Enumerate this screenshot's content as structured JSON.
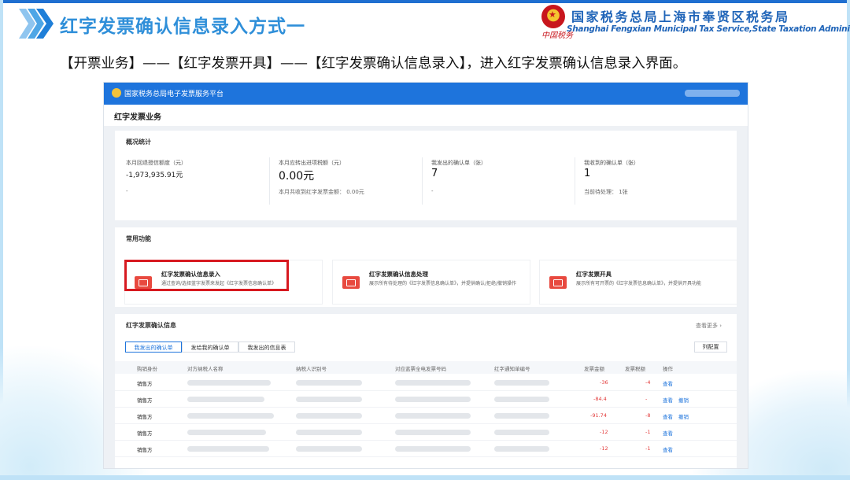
{
  "slide": {
    "title": "红字发票确认信息录入方式一",
    "agency_cn": "国家税务总局上海市奉贤区税务局",
    "agency_en": "Shanghai Fengxian Municipal Tax Service,State Taxation Administration",
    "agency_calligraphy": "中国税务",
    "instruction": "【开票业务】——【红字发票开具】——【红字发票确认信息录入】，进入红字发票确认信息录入界面。",
    "colors": {
      "title_blue": "#2f8fd9",
      "agency_blue": "#1f64b8",
      "highlight_red": "#d71920"
    }
  },
  "app": {
    "platform_title": "国家税务总局电子发票服务平台",
    "page_title": "红字发票业务",
    "colors": {
      "topbar": "#1e74dc",
      "amount_red": "#e23b3b",
      "link_blue": "#1e74dc"
    }
  },
  "overview": {
    "title": "概况统计",
    "stats": [
      {
        "label": "本月回退授信额度（元）",
        "value": "-1,973,935.91元",
        "sub": "-"
      },
      {
        "label": "本月应转出进项税额（元）",
        "value": "0.00元",
        "sub": "本月共收到红字发票金额：  0.00元"
      },
      {
        "label": "我发出的确认单（张）",
        "value": "7",
        "sub": "-"
      },
      {
        "label": "我收到的确认单（张）",
        "value": "1",
        "sub": "当前待处理：  1张"
      }
    ]
  },
  "common_functions": {
    "title": "常用功能",
    "items": [
      {
        "name": "红字发票确认信息录入",
        "desc": "通过查询/选择蓝字发票来发起《红字发票信息确认单》"
      },
      {
        "name": "红字发票确认信息处理",
        "desc": "展示所有待处理的《红字发票信息确认单》，并提供确认/拒绝/撤销操作"
      },
      {
        "name": "红字发票开具",
        "desc": "展示所有可开票的《红字发票信息确认单》，并提供开具功能"
      }
    ]
  },
  "confirm_info": {
    "title": "红字发票确认信息",
    "more_link": "查看更多 ›",
    "tabs": [
      "我发出的确认单",
      "发给我的确认单",
      "我发出的信息表"
    ],
    "column_config_button": "列配置",
    "columns": [
      "购销身份",
      "对方纳税人名称",
      "纳税人识别号",
      "对应蓝票全电发票号码",
      "红字通知单编号",
      "发票金额",
      "发票税额",
      "操作"
    ],
    "rows": [
      {
        "role": "销售方",
        "amount": "-36",
        "tax": "-4",
        "actions": [
          "查看"
        ]
      },
      {
        "role": "销售方",
        "amount": "-84.4",
        "tax": "-",
        "actions": [
          "查看",
          "撤销"
        ]
      },
      {
        "role": "销售方",
        "amount": "-91.74",
        "tax": "-8",
        "actions": [
          "查看",
          "撤销"
        ]
      },
      {
        "role": "销售方",
        "amount": "-12",
        "tax": "-1",
        "actions": [
          "查看"
        ]
      },
      {
        "role": "销售方",
        "amount": "-12",
        "tax": "-1",
        "actions": [
          "查看"
        ]
      }
    ]
  }
}
